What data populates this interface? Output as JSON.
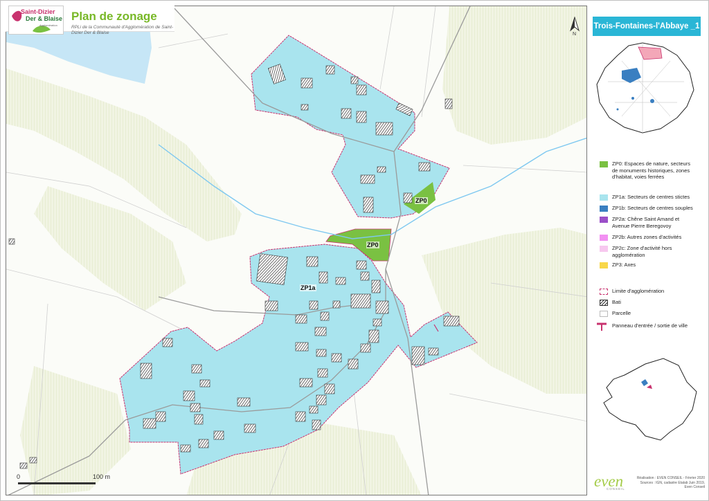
{
  "header": {
    "logo_line1": "Saint-Dizier",
    "logo_line2": "Der & Blaise",
    "logo_line3": "Agglomération",
    "title": "Plan de zonage",
    "subtitle": "RPLi de la Communauté d'Agglomération de Saint-Dizier Der & Blaise"
  },
  "north_arrow": {
    "label": "N"
  },
  "scale_bar": {
    "start_label": "0",
    "end_label": "100 m"
  },
  "commune_name": "Trois-Fontaines-l'Abbaye _1",
  "zone_labels": {
    "zp0_a": "ZP0",
    "zp0_b": "ZP0",
    "zp1a": "ZP1a"
  },
  "legend": {
    "zones": [
      {
        "label": "ZP0: Espaces de nature, secteurs de monuments historiques, zones d'habitat, voies ferrées",
        "color": "#7ac142"
      },
      {
        "label": "ZP1a: Secteurs de centres stictes",
        "color": "#a9e4ee"
      },
      {
        "label": "ZP1b: Secteurs de centres souples",
        "color": "#3a7fc1"
      },
      {
        "label": "ZP2a: Chêne Saint Amand et Avenue Pierre Beregovoy",
        "color": "#9b4fc8"
      },
      {
        "label": "ZP2b: Autres zones d'activités",
        "color": "#f290f2"
      },
      {
        "label": "ZP2c: Zone d'activité hors agglomération",
        "color": "#f7c8ef"
      },
      {
        "label": "ZP3: Axes",
        "color": "#f8d74a"
      }
    ],
    "other": [
      {
        "label": "Limite d'agglomération"
      },
      {
        "label": "Bati"
      },
      {
        "label": "Parcelle"
      },
      {
        "label": "Panneau d'entrée / sortie de ville"
      }
    ]
  },
  "credits": {
    "signature": "even",
    "signature_sub": "CONSEIL",
    "line1": "Réalisation : EVEN CONSEIL - Février 2020",
    "line2": "Sources : IGN, cadastre Etalab Juin 2019,",
    "line3": "Even Conseil"
  }
}
